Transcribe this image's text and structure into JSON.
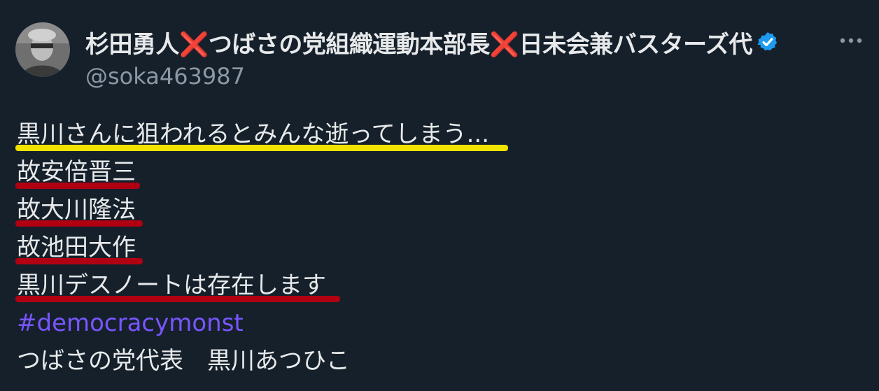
{
  "author": {
    "display_name": "杉田勇人❌つばさの党組織運動本部長❌日未会兼バスターズ代",
    "handle": "@soka463987",
    "verified_icon": "verified-badge-icon",
    "avatar_icon": "user-avatar"
  },
  "menu": {
    "more_icon": "more-horizontal-icon"
  },
  "post": {
    "lines": [
      "黒川さんに狙われるとみんな逝ってしまう...",
      "故安倍晋三",
      "故大川隆法",
      "故池田大作",
      "黒川デスノートは存在します"
    ],
    "hashtag": "#democracymonst",
    "signature": "つばさの党代表　黒川あつひこ"
  },
  "colors": {
    "background": "#15202b",
    "text": "#e7e9ea",
    "muted": "#8b98a5",
    "hashtag": "#7856ff",
    "verified": "#1d9bf0",
    "highlight_yellow": "#f2e200",
    "highlight_red": "#b00012"
  }
}
